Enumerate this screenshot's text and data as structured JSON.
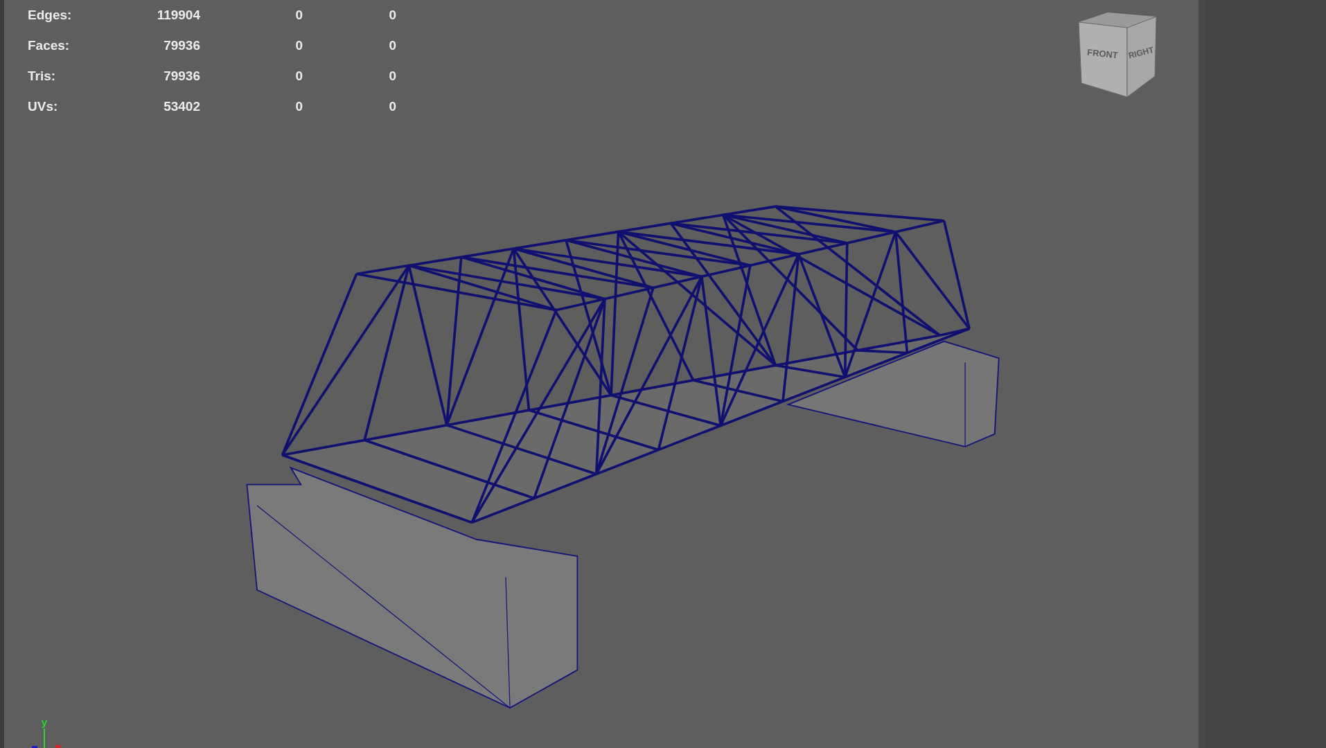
{
  "stats": [
    {
      "label": "Edges:",
      "values": [
        "119904",
        "0",
        "0"
      ]
    },
    {
      "label": "Faces:",
      "values": [
        "79936",
        "0",
        "0"
      ]
    },
    {
      "label": "Tris:",
      "values": [
        "79936",
        "0",
        "0"
      ]
    },
    {
      "label": "UVs:",
      "values": [
        "53402",
        "0",
        "0"
      ]
    }
  ],
  "view_cube": {
    "faces": [
      "FRONT",
      "RIGHT"
    ]
  },
  "axis": {
    "label": "y"
  }
}
